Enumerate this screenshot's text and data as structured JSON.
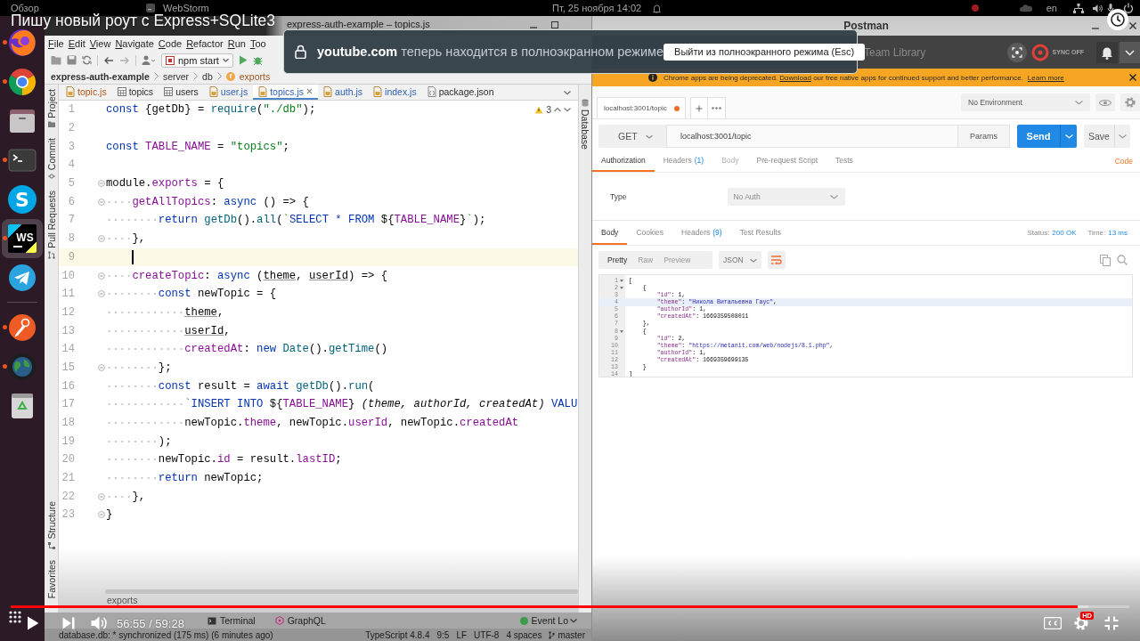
{
  "topbar": {
    "activities": "Обзор",
    "app": "WebStorm",
    "clock": "Пт, 25 ноября 14:02",
    "language": "en"
  },
  "video": {
    "title": "Пишу новый роут с Express+SQLite3",
    "time": "56:55 / 59:28",
    "quality": "HD",
    "progress": {
      "level": 0.954
    },
    "buffer": {
      "level": 0.963
    }
  },
  "fullscreen_notice": {
    "message": "**youtube.com** теперь находится в полноэкранном режиме",
    "button": "Выйти из полноэкранного режима (Esc)"
  },
  "dock": {
    "groups": [
      {
        "items": [
          {
            "kind": "fox",
            "running": true,
            "selected": false
          },
          {
            "kind": "wheel",
            "running": true,
            "selected": false
          },
          {
            "kind": "folder",
            "running": false,
            "selected": false
          },
          {
            "kind": "terminal",
            "running": true,
            "selected": false
          },
          {
            "kind": "bubble",
            "glyph": "S",
            "running": false,
            "selected": false
          },
          {
            "kind": "ide",
            "glyph": "WS",
            "running": true,
            "selected": true
          },
          {
            "kind": "plane",
            "running": false,
            "selected": false
          }
        ]
      },
      {
        "items": [
          {
            "kind": "astronaut",
            "running": true,
            "selected": false
          },
          {
            "kind": "globe",
            "running": true,
            "selected": false
          },
          {
            "kind": "trash",
            "running": false,
            "selected": false
          }
        ]
      }
    ]
  },
  "ide": {
    "title": "express-auth-example – topics.js",
    "menu": [
      "File",
      "Edit",
      "View",
      "Navigate",
      "Code",
      "Refactor",
      "Run",
      "Too"
    ],
    "run_config": "npm start",
    "breadcrumb": [
      {
        "label": "express-auth-example",
        "kind": "project"
      },
      {
        "label": "server",
        "kind": "folder"
      },
      {
        "label": "db",
        "kind": "folder"
      },
      {
        "label": "exports",
        "kind": "symbol",
        "badge": "f"
      }
    ],
    "tabs": [
      {
        "label": "topic.js",
        "kind": "script",
        "error": true,
        "modified": false,
        "selected": false
      },
      {
        "label": "topics",
        "kind": "table",
        "error": false,
        "modified": false,
        "selected": false
      },
      {
        "label": "users",
        "kind": "table",
        "error": false,
        "modified": false,
        "selected": false
      },
      {
        "label": "user.js",
        "kind": "script",
        "error": false,
        "modified": true,
        "selected": false
      },
      {
        "label": "topics.js",
        "kind": "script",
        "error": false,
        "modified": true,
        "selected": true
      },
      {
        "label": "auth.js",
        "kind": "script",
        "error": false,
        "modified": true,
        "selected": false
      },
      {
        "label": "index.js",
        "kind": "script",
        "error": false,
        "modified": true,
        "selected": false
      },
      {
        "label": "package.json",
        "kind": "config",
        "error": false,
        "modified": false,
        "selected": false
      }
    ],
    "tool_stripe_top": [
      {
        "label": "Project",
        "kind": "folder"
      },
      {
        "label": "Commit",
        "kind": "commit"
      },
      {
        "label": "Pull Requests",
        "kind": "pull"
      }
    ],
    "tool_stripe_bottom": [
      {
        "label": "Structure",
        "kind": "structure"
      },
      {
        "label": "Favorites",
        "kind": "plain"
      }
    ],
    "side_panel": {
      "label": "Database"
    },
    "warnings": "3",
    "lines": [
      {
        "number": "1",
        "fold": false,
        "current": false,
        "tokens": [
          {
            "text": "const",
            "kind": "kw"
          },
          {
            "text": " {getDb} = ",
            "kind": "plain"
          },
          {
            "text": "require",
            "kind": "fn"
          },
          {
            "text": "(",
            "kind": "plain"
          },
          {
            "text": "\"./db\"",
            "kind": "str"
          },
          {
            "text": ");",
            "kind": "plain"
          }
        ]
      },
      {
        "number": "2",
        "fold": false,
        "current": false
      },
      {
        "number": "3",
        "fold": false,
        "current": false,
        "tokens": [
          {
            "text": "const ",
            "kind": "kw"
          },
          {
            "text": "TABLE_NAME",
            "kind": "prop"
          },
          {
            "text": " = ",
            "kind": "plain"
          },
          {
            "text": "\"topics\"",
            "kind": "str"
          },
          {
            "text": ";",
            "kind": "plain"
          }
        ]
      },
      {
        "number": "4",
        "fold": false,
        "current": false
      },
      {
        "number": "5",
        "fold": true,
        "current": false,
        "tokens": [
          {
            "text": "module.",
            "kind": "plain"
          },
          {
            "text": "exports",
            "kind": "prop"
          },
          {
            "text": " = {",
            "kind": "plain"
          }
        ]
      },
      {
        "number": "6",
        "fold": true,
        "current": false,
        "tokens": [
          {
            "text": "    getAllTopics",
            "kind": "prop"
          },
          {
            "text": ": ",
            "kind": "plain"
          },
          {
            "text": "async",
            "kind": "kw"
          },
          {
            "text": " () => {",
            "kind": "plain"
          }
        ]
      },
      {
        "number": "7",
        "fold": false,
        "current": false,
        "tokens": [
          {
            "text": "        return ",
            "kind": "kw"
          },
          {
            "text": "getDb",
            "kind": "fn"
          },
          {
            "text": "().",
            "kind": "plain"
          },
          {
            "text": "all",
            "kind": "fn"
          },
          {
            "text": "(",
            "kind": "plain"
          },
          {
            "text": "`",
            "kind": "str"
          },
          {
            "text": "SELECT * FROM ",
            "kind": "sqlkw"
          },
          {
            "text": "${",
            "kind": "plain"
          },
          {
            "text": "TABLE_NAME",
            "kind": "prop"
          },
          {
            "text": "}",
            "kind": "plain"
          },
          {
            "text": "`",
            "kind": "str"
          },
          {
            "text": ");",
            "kind": "plain"
          }
        ]
      },
      {
        "number": "8",
        "fold": true,
        "current": false,
        "tokens": [
          {
            "text": "    },",
            "kind": "plain"
          }
        ]
      },
      {
        "number": "9",
        "fold": false,
        "current": true
      },
      {
        "number": "10",
        "fold": true,
        "current": false,
        "tokens": [
          {
            "text": "    createTopic",
            "kind": "prop"
          },
          {
            "text": ": ",
            "kind": "plain"
          },
          {
            "text": "async",
            "kind": "kw"
          },
          {
            "text": " (",
            "kind": "plain"
          },
          {
            "text": "theme",
            "kind": "param"
          },
          {
            "text": ", ",
            "kind": "plain"
          },
          {
            "text": "userId",
            "kind": "param"
          },
          {
            "text": ") => {",
            "kind": "plain"
          }
        ]
      },
      {
        "number": "11",
        "fold": true,
        "current": false,
        "tokens": [
          {
            "text": "        const",
            "kind": "kw"
          },
          {
            "text": " newTopic = {",
            "kind": "plain"
          }
        ]
      },
      {
        "number": "12",
        "fold": false,
        "current": false,
        "tokens": [
          {
            "text": "            theme",
            "kind": "param"
          },
          {
            "text": ",",
            "kind": "plain"
          }
        ]
      },
      {
        "number": "13",
        "fold": false,
        "current": false,
        "tokens": [
          {
            "text": "            userId",
            "kind": "param"
          },
          {
            "text": ",",
            "kind": "plain"
          }
        ]
      },
      {
        "number": "14",
        "fold": false,
        "current": false,
        "tokens": [
          {
            "text": "            createdAt",
            "kind": "prop"
          },
          {
            "text": ": ",
            "kind": "plain"
          },
          {
            "text": "new ",
            "kind": "kw"
          },
          {
            "text": "Date",
            "kind": "fn"
          },
          {
            "text": "().",
            "kind": "plain"
          },
          {
            "text": "getTime",
            "kind": "fn"
          },
          {
            "text": "()",
            "kind": "plain"
          }
        ]
      },
      {
        "number": "15",
        "fold": true,
        "current": false,
        "tokens": [
          {
            "text": "        };",
            "kind": "plain"
          }
        ]
      },
      {
        "number": "16",
        "fold": false,
        "current": false,
        "tokens": [
          {
            "text": "        const",
            "kind": "kw"
          },
          {
            "text": " result = ",
            "kind": "plain"
          },
          {
            "text": "await ",
            "kind": "kw"
          },
          {
            "text": "getDb",
            "kind": "fn"
          },
          {
            "text": "().",
            "kind": "plain"
          },
          {
            "text": "run",
            "kind": "fn"
          },
          {
            "text": "(",
            "kind": "plain"
          }
        ]
      },
      {
        "number": "17",
        "fold": false,
        "current": false,
        "tokens": [
          {
            "text": "            `",
            "kind": "str"
          },
          {
            "text": "INSERT INTO ",
            "kind": "sqlkw"
          },
          {
            "text": "${",
            "kind": "plain"
          },
          {
            "text": "TABLE_NAME",
            "kind": "prop"
          },
          {
            "text": "} ",
            "kind": "plain"
          },
          {
            "text": "(theme, authorId, createdAt)",
            "kind": "sqlid"
          },
          {
            "text": " VALU",
            "kind": "sqlkw"
          }
        ]
      },
      {
        "number": "18",
        "fold": false,
        "current": false,
        "tokens": [
          {
            "text": "            newTopic.",
            "kind": "plain"
          },
          {
            "text": "theme",
            "kind": "prop"
          },
          {
            "text": ", newTopic.",
            "kind": "plain"
          },
          {
            "text": "userId",
            "kind": "prop"
          },
          {
            "text": ", newTopic.",
            "kind": "plain"
          },
          {
            "text": "createdAt",
            "kind": "prop"
          }
        ]
      },
      {
        "number": "19",
        "fold": false,
        "current": false,
        "tokens": [
          {
            "text": "        );",
            "kind": "plain"
          }
        ]
      },
      {
        "number": "20",
        "fold": false,
        "current": false,
        "tokens": [
          {
            "text": "        newTopic.",
            "kind": "plain"
          },
          {
            "text": "id",
            "kind": "prop"
          },
          {
            "text": " = result.",
            "kind": "plain"
          },
          {
            "text": "lastID",
            "kind": "prop"
          },
          {
            "text": ";",
            "kind": "plain"
          }
        ]
      },
      {
        "number": "21",
        "fold": false,
        "current": false,
        "tokens": [
          {
            "text": "        return",
            "kind": "kw"
          },
          {
            "text": " newTopic;",
            "kind": "plain"
          }
        ]
      },
      {
        "number": "22",
        "fold": true,
        "current": false,
        "tokens": [
          {
            "text": "    },",
            "kind": "plain"
          }
        ]
      },
      {
        "number": "23",
        "fold": true,
        "current": false,
        "tokens": [
          {
            "text": "}",
            "kind": "plain"
          }
        ]
      }
    ],
    "footer_path": "exports",
    "tool_windows": [
      {
        "label": "Terminal",
        "kind": "terminal"
      },
      {
        "label": "GraphQL",
        "kind": "graphql"
      }
    ],
    "event_log": "Event Lo",
    "status": {
      "message": "database.db: * synchronized (175 ms) (6 minutes ago)",
      "language": "TypeScript 4.8.4",
      "position": "9:5",
      "line_ending": "LF",
      "encoding": "UTF-8",
      "indent": "4 spaces",
      "branch": "master"
    }
  },
  "postman": {
    "title": "Postman",
    "library": "Team Library",
    "sync": "SYNC OFF",
    "banner": {
      "before": "Chrome apps are being deprecated.",
      "link": "Download",
      "after": "our free native apps for continued support and better performance.",
      "more": "Learn more"
    },
    "tabs": [
      {
        "label": "localhost:3001/topic",
        "unsaved": true
      }
    ],
    "environment": "No Environment",
    "method": "GET",
    "url": "localhost:3001/topic",
    "params": "Params",
    "send": "Send",
    "save": "Save",
    "request_tabs": [
      {
        "label": "Authorization",
        "selected": true,
        "disabled": false
      },
      {
        "label": "Headers",
        "count": "(1)",
        "selected": false,
        "disabled": false
      },
      {
        "label": "Body",
        "selected": false,
        "disabled": true
      },
      {
        "label": "Pre-request Script",
        "selected": false,
        "disabled": false
      },
      {
        "label": "Tests",
        "selected": false,
        "disabled": false
      }
    ],
    "code": "Code",
    "auth": {
      "label": "Type",
      "value": "No Auth"
    },
    "response_tabs": [
      {
        "label": "Body",
        "selected": true
      },
      {
        "label": "Cookies",
        "selected": false
      },
      {
        "label": "Headers",
        "count": "(9)",
        "selected": false
      },
      {
        "label": "Test Results",
        "selected": false
      }
    ],
    "status": {
      "label": "Status:",
      "value": "200 OK"
    },
    "time": {
      "label": "Time:",
      "value": "13 ms"
    },
    "views": [
      {
        "label": "Pretty",
        "selected": true
      },
      {
        "label": "Raw",
        "selected": false
      },
      {
        "label": "Preview",
        "selected": false
      }
    ],
    "format": "JSON",
    "body_lines": [
      {
        "number": "1",
        "fold": true,
        "current": false,
        "tokens": [
          {
            "text": "[",
            "kind": "punct"
          }
        ]
      },
      {
        "number": "2",
        "fold": true,
        "current": false,
        "tokens": [
          {
            "text": "    {",
            "kind": "punct"
          }
        ]
      },
      {
        "number": "3",
        "fold": false,
        "current": false,
        "tokens": [
          {
            "text": "        \"id\"",
            "kind": "key"
          },
          {
            "text": ": ",
            "kind": "punct"
          },
          {
            "text": "1",
            "kind": "num"
          },
          {
            "text": ",",
            "kind": "punct"
          }
        ]
      },
      {
        "number": "4",
        "fold": false,
        "current": true,
        "tokens": [
          {
            "text": "        \"theme\"",
            "kind": "key"
          },
          {
            "text": ": ",
            "kind": "punct"
          },
          {
            "text": "\"Никола Витальевна Гаус\"",
            "kind": "str"
          },
          {
            "text": ",",
            "kind": "punct"
          }
        ]
      },
      {
        "number": "5",
        "fold": false,
        "current": false,
        "tokens": [
          {
            "text": "        \"authorId\"",
            "kind": "key"
          },
          {
            "text": ": ",
            "kind": "punct"
          },
          {
            "text": "1",
            "kind": "num"
          },
          {
            "text": ",",
            "kind": "punct"
          }
        ]
      },
      {
        "number": "6",
        "fold": false,
        "current": false,
        "tokens": [
          {
            "text": "        \"createdAt\"",
            "kind": "key"
          },
          {
            "text": ": ",
            "kind": "punct"
          },
          {
            "text": "1669359508011",
            "kind": "num"
          }
        ]
      },
      {
        "number": "7",
        "fold": false,
        "current": false,
        "tokens": [
          {
            "text": "    },",
            "kind": "punct"
          }
        ]
      },
      {
        "number": "8",
        "fold": true,
        "current": false,
        "tokens": [
          {
            "text": "    {",
            "kind": "punct"
          }
        ]
      },
      {
        "number": "9",
        "fold": false,
        "current": false,
        "tokens": [
          {
            "text": "        \"id\"",
            "kind": "key"
          },
          {
            "text": ": ",
            "kind": "punct"
          },
          {
            "text": "2",
            "kind": "num"
          },
          {
            "text": ",",
            "kind": "punct"
          }
        ]
      },
      {
        "number": "10",
        "fold": false,
        "current": false,
        "tokens": [
          {
            "text": "        \"theme\"",
            "kind": "key"
          },
          {
            "text": ": ",
            "kind": "punct"
          },
          {
            "text": "\"https://metanit.com/web/nodejs/8.1.php\"",
            "kind": "str"
          },
          {
            "text": ",",
            "kind": "punct"
          }
        ]
      },
      {
        "number": "11",
        "fold": false,
        "current": false,
        "tokens": [
          {
            "text": "        \"authorId\"",
            "kind": "key"
          },
          {
            "text": ": ",
            "kind": "punct"
          },
          {
            "text": "1",
            "kind": "num"
          },
          {
            "text": ",",
            "kind": "punct"
          }
        ]
      },
      {
        "number": "12",
        "fold": false,
        "current": false,
        "tokens": [
          {
            "text": "        \"createdAt\"",
            "kind": "key"
          },
          {
            "text": ": ",
            "kind": "punct"
          },
          {
            "text": "1669359699135",
            "kind": "num"
          }
        ]
      },
      {
        "number": "13",
        "fold": false,
        "current": false,
        "tokens": [
          {
            "text": "    }",
            "kind": "punct"
          }
        ]
      },
      {
        "number": "14",
        "fold": false,
        "current": false,
        "tokens": [
          {
            "text": "]",
            "kind": "punct"
          }
        ]
      }
    ]
  }
}
